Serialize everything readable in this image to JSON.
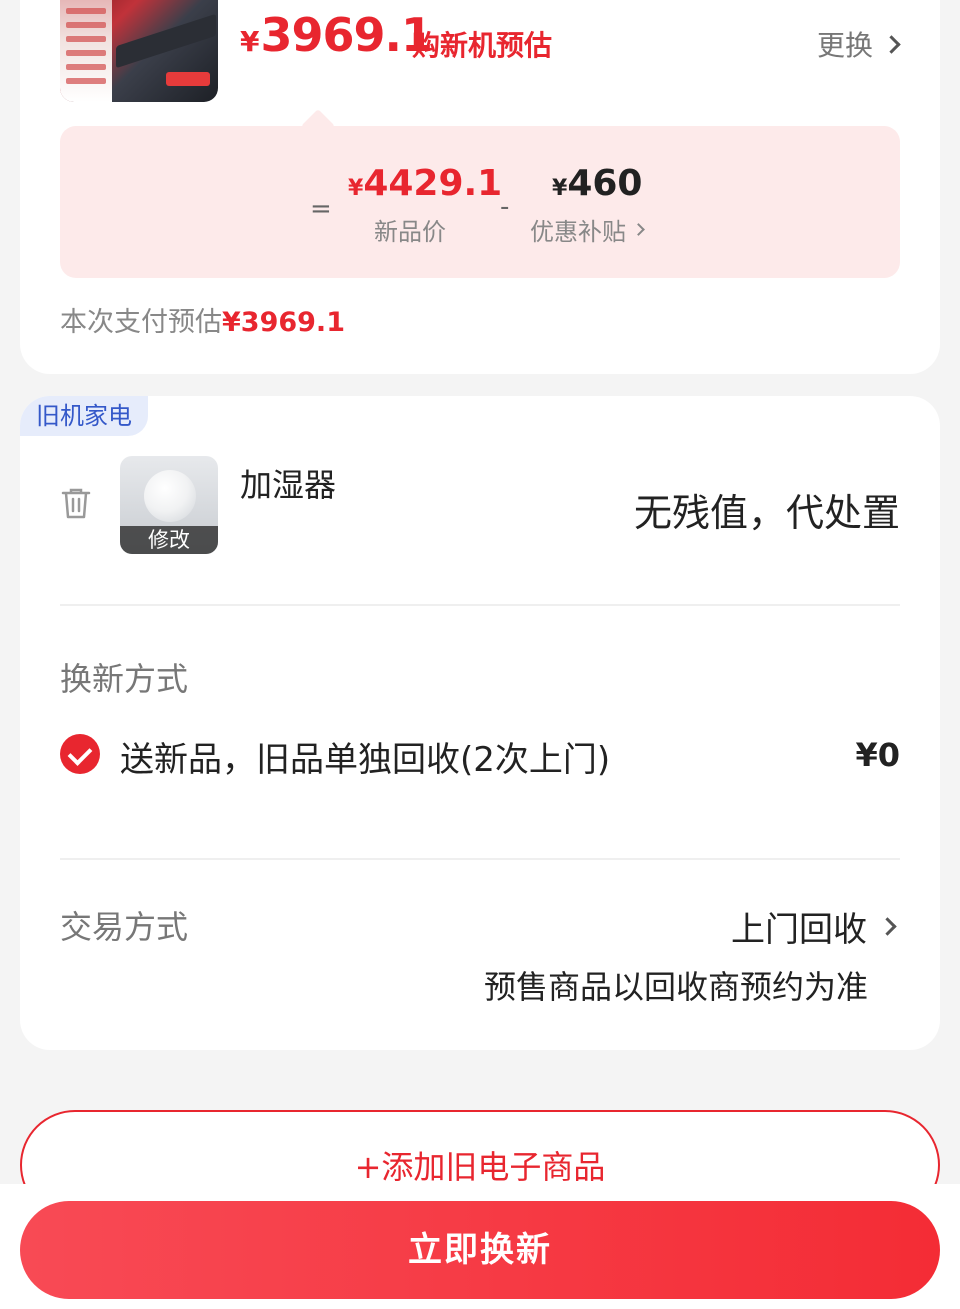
{
  "new_item": {
    "price_symbol": "¥",
    "price": "3969.1",
    "price_tip": "购新机预估",
    "change_label": "更换"
  },
  "calc": {
    "equals": "=",
    "minus": "-",
    "new_price_symbol": "¥",
    "new_price": "4429.1",
    "new_price_label": "新品价",
    "subsidy_symbol": "¥",
    "subsidy": "460",
    "subsidy_label": "优惠补贴"
  },
  "payment": {
    "label": "本次支付预估",
    "amount": "¥3969.1"
  },
  "old_item": {
    "tag": "旧机家电",
    "name": "加湿器",
    "edit_label": "修改",
    "value_text": "无残值，代处置"
  },
  "replace_method": {
    "label": "换新方式",
    "option_text": "送新品，旧品单独回收(2次上门)",
    "option_price": "¥0"
  },
  "trade_method": {
    "label": "交易方式",
    "value": "上门回收",
    "note": "预售商品以回收商预约为准"
  },
  "buttons": {
    "add_old": "+添加旧电子商品",
    "submit": "立即换新"
  },
  "colors": {
    "accent": "#e8262f",
    "tag_bg": "#e6ecfb",
    "tag_text": "#3458c9",
    "calc_bg": "#fdeaea"
  },
  "icons": [
    "chevron-right-icon",
    "trash-icon",
    "check-circle-icon"
  ]
}
